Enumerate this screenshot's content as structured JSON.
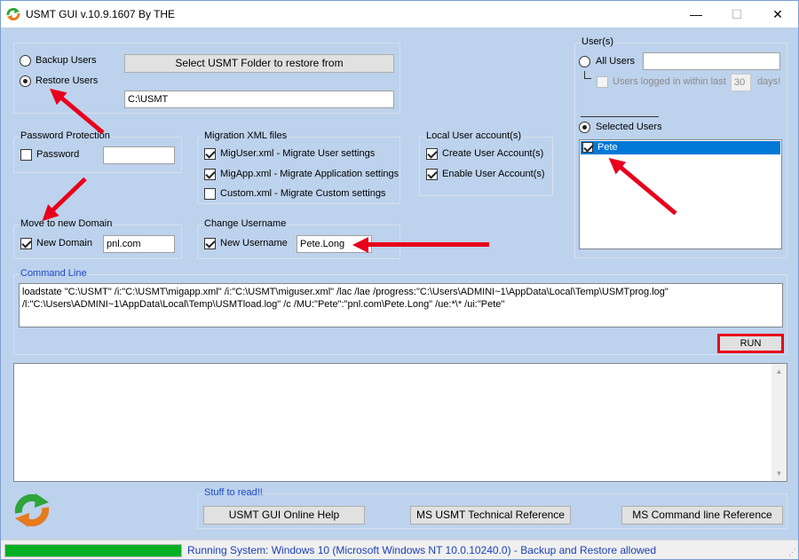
{
  "window": {
    "title": "USMT GUI v.10.9.1607 By THE",
    "controls": {
      "minimize": "—",
      "maximize": "☐",
      "close": "✕"
    }
  },
  "mode": {
    "backup_label": "Backup Users",
    "restore_label": "Restore Users",
    "selected": "restore",
    "select_folder_button": "Select USMT Folder to restore from",
    "folder_path": "C:\\USMT"
  },
  "password": {
    "group_label": "Password Protection",
    "checkbox_label": "Password",
    "checked": false,
    "value": ""
  },
  "migration_xml": {
    "group_label": "Migration XML files",
    "items": [
      {
        "label": "MigUser.xml - Migrate User settings",
        "checked": true
      },
      {
        "label": "MigApp.xml - Migrate Application settings",
        "checked": true
      },
      {
        "label": "Custom.xml - Migrate Custom settings",
        "checked": false
      }
    ]
  },
  "local_accounts": {
    "group_label": "Local User account(s)",
    "items": [
      {
        "label": "Create User Account(s)",
        "checked": true
      },
      {
        "label": "Enable User Account(s)",
        "checked": true
      }
    ]
  },
  "domain": {
    "group_label": "Move to new Domain",
    "checkbox_label": "New Domain",
    "checked": true,
    "value": "pnl.com"
  },
  "username": {
    "group_label": "Change Username",
    "checkbox_label": "New Username",
    "checked": true,
    "value": "Pete.Long"
  },
  "users": {
    "group_label": "User(s)",
    "all_users_label": "All Users",
    "all_users_value": "",
    "logged_in_label": "Users logged in within last",
    "logged_in_days_value": "30",
    "days_label": "days!",
    "selected_users_label": "Selected Users",
    "selected": "selected",
    "list": [
      {
        "name": "Pete",
        "checked": true
      }
    ]
  },
  "command_line": {
    "group_label": "Command Line",
    "text": "loadstate \"C:\\USMT\" /i:\"C:\\USMT\\migapp.xml\" /i:\"C:\\USMT\\miguser.xml\" /lac /lae /progress:\"C:\\Users\\ADMINI~1\\AppData\\Local\\Temp\\USMTprog.log\" /l:\"C:\\Users\\ADMINI~1\\AppData\\Local\\Temp\\USMTload.log\" /c /MU:\"Pete\":\"pnl.com\\Pete.Long\" /ue:*\\* /ui:\"Pete\"",
    "run_button": "RUN"
  },
  "output": {
    "text": ""
  },
  "stuff": {
    "group_label": "Stuff to read!!",
    "buttons": [
      "USMT GUI Online Help",
      "MS USMT Technical Reference",
      "MS Command line Reference"
    ]
  },
  "status": {
    "progress_percent": 100,
    "text": "Running System: Windows 10  (Microsoft Windows NT 10.0.10240.0) - Backup and Restore allowed"
  },
  "icons": {
    "app_icon": "recycle-arrows-icon",
    "footer_logo": "recycle-arrows-icon",
    "annotation": "red-arrow-icon"
  },
  "colors": {
    "background": "#bdd2ec",
    "selection": "#0078d7",
    "annotation": "#e8001c",
    "progress": "#06b025",
    "group_label_blue": "#1e49c8"
  }
}
